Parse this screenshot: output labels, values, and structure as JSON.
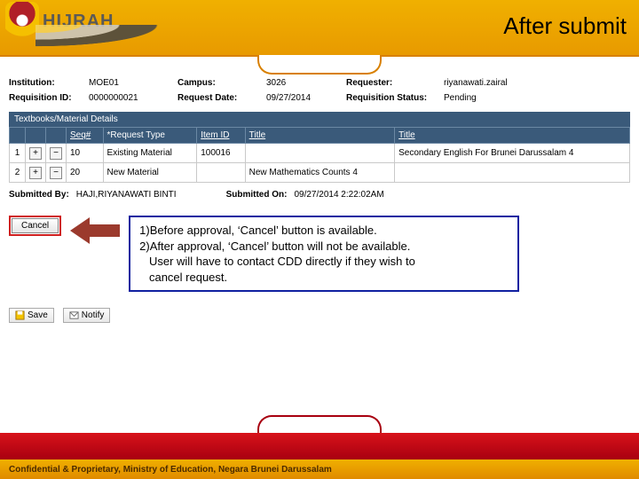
{
  "header": {
    "brand": "HIJRAH",
    "title": "After submit"
  },
  "fields": {
    "institution_lab": "Institution:",
    "institution": "MOE01",
    "campus_lab": "Campus:",
    "campus": "3026",
    "requester_lab": "Requester:",
    "requester": "riyanawati.zairal",
    "reqid_lab": "Requisition ID:",
    "reqid": "0000000021",
    "reqdate_lab": "Request Date:",
    "reqdate": "09/27/2014",
    "status_lab": "Requisition Status:",
    "status": "Pending"
  },
  "section_title": "Textbooks/Material Details",
  "cols": {
    "seq": "Seq#",
    "rtype": "*Request Type",
    "item": "Item ID",
    "title1": "Title",
    "title2": "Title"
  },
  "rows": [
    {
      "n": "1",
      "seq": "10",
      "rtype": "Existing Material",
      "item": "100016",
      "title1": "",
      "title2": "Secondary English For Brunei Darussalam 4"
    },
    {
      "n": "2",
      "seq": "20",
      "rtype": "New Material",
      "item": "",
      "title1": "New Mathematics Counts 4",
      "title2": ""
    }
  ],
  "submitted": {
    "by_lab": "Submitted By:",
    "by": "HAJI,RIYANAWATI BINTI",
    "on_lab": "Submitted On:",
    "on": "09/27/2014 2:22:02AM"
  },
  "cancel_label": "Cancel",
  "note": {
    "l1": "1)Before approval, ‘Cancel’ button is available.",
    "l2": "2)After approval, ‘Cancel’ button will not be available.",
    "l3": "   User will have to contact CDD directly if they wish to",
    "l4": "   cancel request."
  },
  "toolbar": {
    "save": "Save",
    "notify": "Notify"
  },
  "footer_text": "Confidential & Proprietary, Ministry of Education, Negara Brunei Darussalam"
}
